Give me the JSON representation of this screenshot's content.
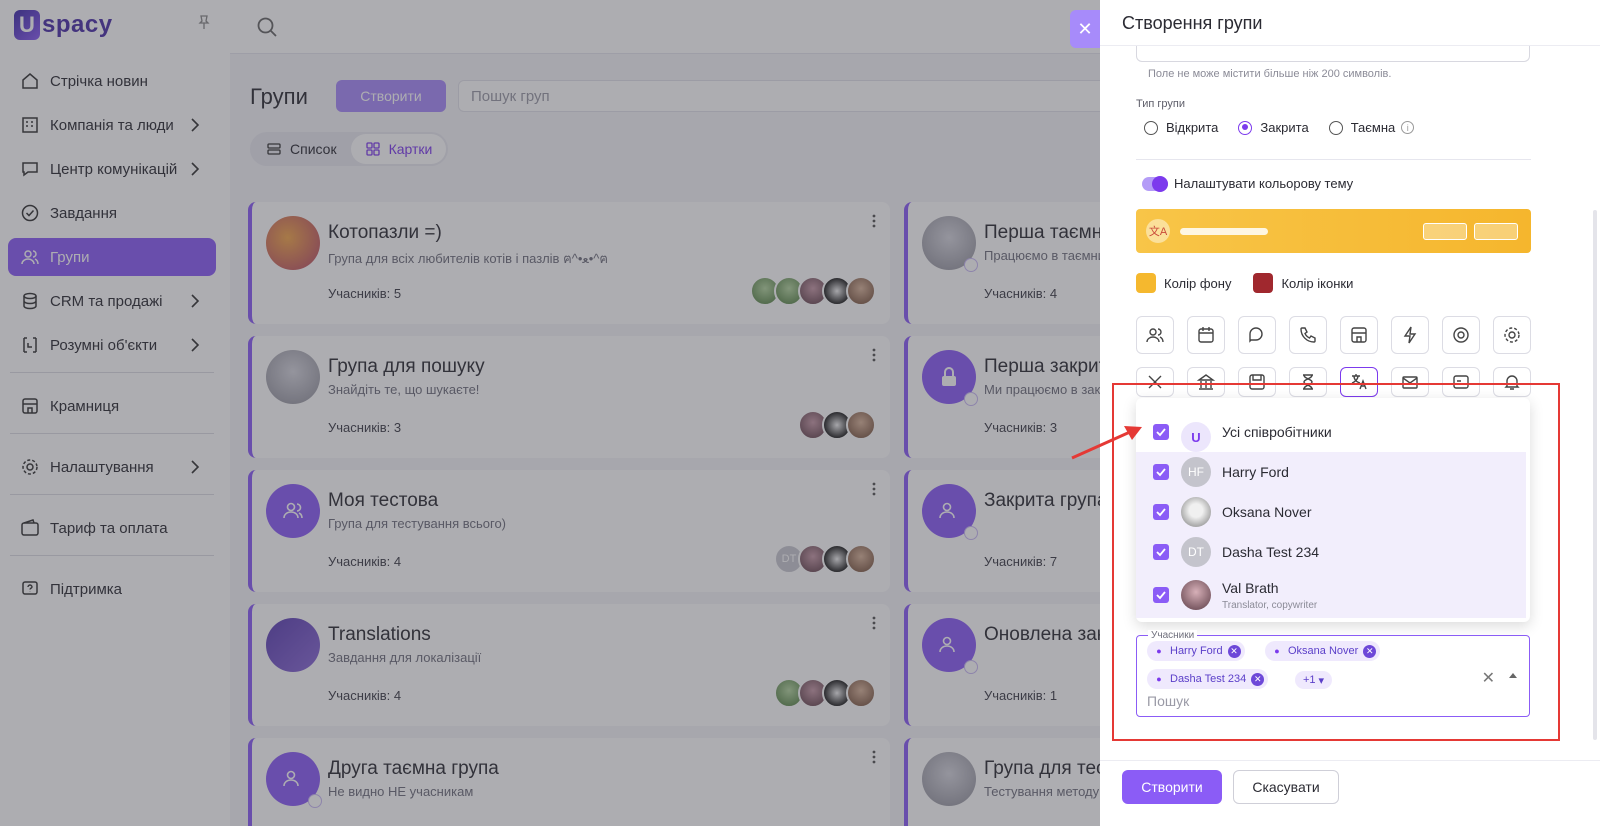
{
  "app": {
    "brand": "spacy",
    "brand_mark": "U"
  },
  "sidebar": {
    "items": [
      {
        "label": "Стрічка новин",
        "icon": "home-icon"
      },
      {
        "label": "Компанія та люди",
        "icon": "building-icon",
        "chevron": true
      },
      {
        "label": "Центр комунікацій",
        "icon": "chat-icon",
        "chevron": true
      },
      {
        "label": "Завдання",
        "icon": "check-circle-icon"
      },
      {
        "label": "Групи",
        "icon": "users-icon",
        "active": true
      },
      {
        "label": "CRM та продажі",
        "icon": "coins-icon",
        "chevron": true
      },
      {
        "label": "Розумні об'єкти",
        "icon": "smart-object-icon",
        "chevron": true
      },
      {
        "label": "Крамниця",
        "icon": "store-icon"
      },
      {
        "label": "Налаштування",
        "icon": "gear-icon",
        "chevron": true
      },
      {
        "label": "Тариф та оплата",
        "icon": "wallet-icon"
      },
      {
        "label": "Підтримка",
        "icon": "help-icon"
      }
    ]
  },
  "main": {
    "title": "Групи",
    "create_label": "Створити",
    "search_placeholder": "Пошук груп",
    "view_list": "Список",
    "view_cards": "Картки"
  },
  "cards": [
    {
      "title": "Котопазли =)",
      "sub": "Група для всіх любителів котів і пазлів ฅ^•ﻌ•^ฅ",
      "count": "Учасників: 5"
    },
    {
      "title": "Перша таємна",
      "sub": "Працюємо в таємниці",
      "count": "Учасників: 4"
    },
    {
      "title": "Група для пошуку",
      "sub": "Знайдіть те, що шукаєте!",
      "count": "Учасників: 3"
    },
    {
      "title": "Перша закрита",
      "sub": "Ми працюємо в закритому",
      "count": "Учасників: 3"
    },
    {
      "title": "Моя тестова",
      "sub": "Група для тестування всього)",
      "count": "Учасників: 4"
    },
    {
      "title": "Закрита група",
      "sub": "",
      "count": "Учасників: 7"
    },
    {
      "title": "Translations",
      "sub": "Завдання для локалізації",
      "count": "Учасників: 4"
    },
    {
      "title": "Оновлена закрита",
      "sub": "",
      "count": "Учасників: 1"
    },
    {
      "title": "Друга таємна група",
      "sub": "Не видно НЕ учасникам",
      "count": ""
    },
    {
      "title": "Група для тесту",
      "sub": "Тестування методу",
      "count": ""
    }
  ],
  "drawer": {
    "title": "Створення групи",
    "hint": "Поле не може містити більше ніж 200 символів.",
    "type_label": "Тип групи",
    "types": [
      {
        "label": "Відкрита",
        "checked": false
      },
      {
        "label": "Закрита",
        "checked": true
      },
      {
        "label": "Таємна",
        "checked": false
      }
    ],
    "theme_toggle": "Налаштувати кольорову тему",
    "bg_color_label": "Колір фону",
    "icon_color_label": "Колір іконки",
    "colors": {
      "background": "#f5b82e",
      "icon": "#a0282e",
      "accent": "#8b5cf6"
    },
    "dropdown": [
      {
        "name": "Усі співробітники",
        "initials": "U",
        "sub": ""
      },
      {
        "name": "Harry Ford",
        "initials": "HF",
        "sub": ""
      },
      {
        "name": "Oksana Nover",
        "initials": "",
        "sub": ""
      },
      {
        "name": "Dasha Test 234",
        "initials": "DT",
        "sub": ""
      },
      {
        "name": "Val Brath",
        "initials": "",
        "sub": "Translator, copywriter"
      }
    ],
    "participants_label": "Учасники",
    "chips": [
      "Harry Ford",
      "Oksana Nover",
      "Dasha Test 234"
    ],
    "more_chip": "+1",
    "participants_search": "Пошук",
    "create_btn": "Створити",
    "cancel_btn": "Скасувати"
  }
}
